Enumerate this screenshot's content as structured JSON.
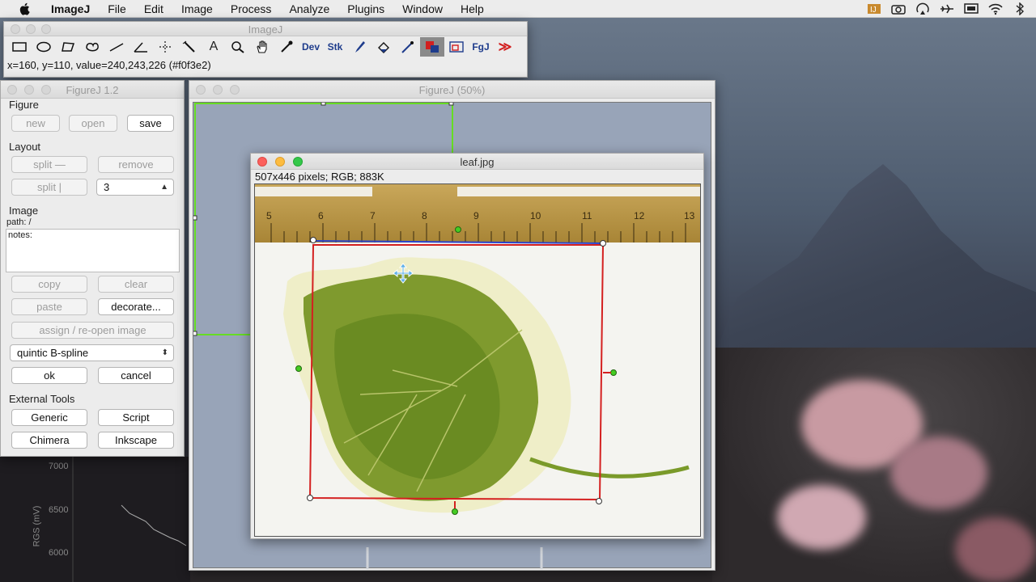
{
  "menubar": {
    "app_name": "ImageJ",
    "items": [
      "File",
      "Edit",
      "Image",
      "Process",
      "Analyze",
      "Plugins",
      "Window",
      "Help"
    ],
    "tray_icons": [
      "imagej-tray-icon",
      "camera-icon",
      "airplay-icon",
      "airplane-icon",
      "display-icon",
      "wifi-icon",
      "bluetooth-icon"
    ]
  },
  "imagej": {
    "title": "ImageJ",
    "tools": [
      {
        "icon": "rectangle-tool-icon"
      },
      {
        "icon": "oval-tool-icon"
      },
      {
        "icon": "polygon-tool-icon"
      },
      {
        "icon": "freehand-tool-icon"
      },
      {
        "icon": "line-tool-icon"
      },
      {
        "icon": "angle-tool-icon"
      },
      {
        "icon": "point-tool-icon"
      },
      {
        "icon": "wand-tool-icon"
      },
      {
        "icon": "text-tool-icon",
        "glyph": "A"
      },
      {
        "icon": "zoom-tool-icon"
      },
      {
        "icon": "hand-tool-icon"
      },
      {
        "icon": "color-picker-icon"
      },
      {
        "icon": "dev-menu-icon",
        "glyph": "Dev"
      },
      {
        "icon": "stk-menu-icon",
        "glyph": "Stk"
      },
      {
        "icon": "brush-tool-icon"
      },
      {
        "icon": "flood-fill-icon"
      },
      {
        "icon": "pipette-icon"
      },
      {
        "icon": "color-tool-icon"
      },
      {
        "icon": "frame-tool-icon"
      },
      {
        "icon": "figurej-tool-icon",
        "glyph": "FgJ"
      },
      {
        "icon": "more-tools-icon",
        "glyph": "≫"
      }
    ],
    "status": "x=160, y=110, value=240,243,226 (#f0f3e2)"
  },
  "figurej": {
    "title": "FigureJ 1.2",
    "figure": {
      "label": "Figure",
      "new": "new",
      "open": "open",
      "save": "save"
    },
    "layout": {
      "label": "Layout",
      "split_h": "split —",
      "remove": "remove",
      "split_v": "split |",
      "split_count": "3"
    },
    "image": {
      "label": "Image",
      "path": "path: /",
      "notes": "notes:",
      "copy": "copy",
      "clear": "clear",
      "paste": "paste",
      "decorate": "decorate...",
      "assign": "assign / re-open image",
      "interpolation": "quintic B-spline",
      "ok": "ok",
      "cancel": "cancel"
    },
    "external": {
      "label": "External Tools",
      "generic": "Generic",
      "script": "Script",
      "chimera": "Chimera",
      "inkscape": "Inkscape"
    }
  },
  "figure_window": {
    "title": "FigureJ (50%)"
  },
  "leaf_window": {
    "title": "leaf.jpg",
    "info": "507x446 pixels; RGB; 883K",
    "ruler_numbers": [
      "5",
      "6",
      "7",
      "8",
      "9",
      "10",
      "11",
      "12",
      "13"
    ]
  },
  "background_plot": {
    "labels": [
      "7000",
      "6500",
      "6000"
    ],
    "axis": "RGS (mV)"
  },
  "colors": {
    "selection": "#d42020",
    "panel_outline": "#66dd22",
    "handle": "#33cc22",
    "accent": "#1e3c8c"
  }
}
